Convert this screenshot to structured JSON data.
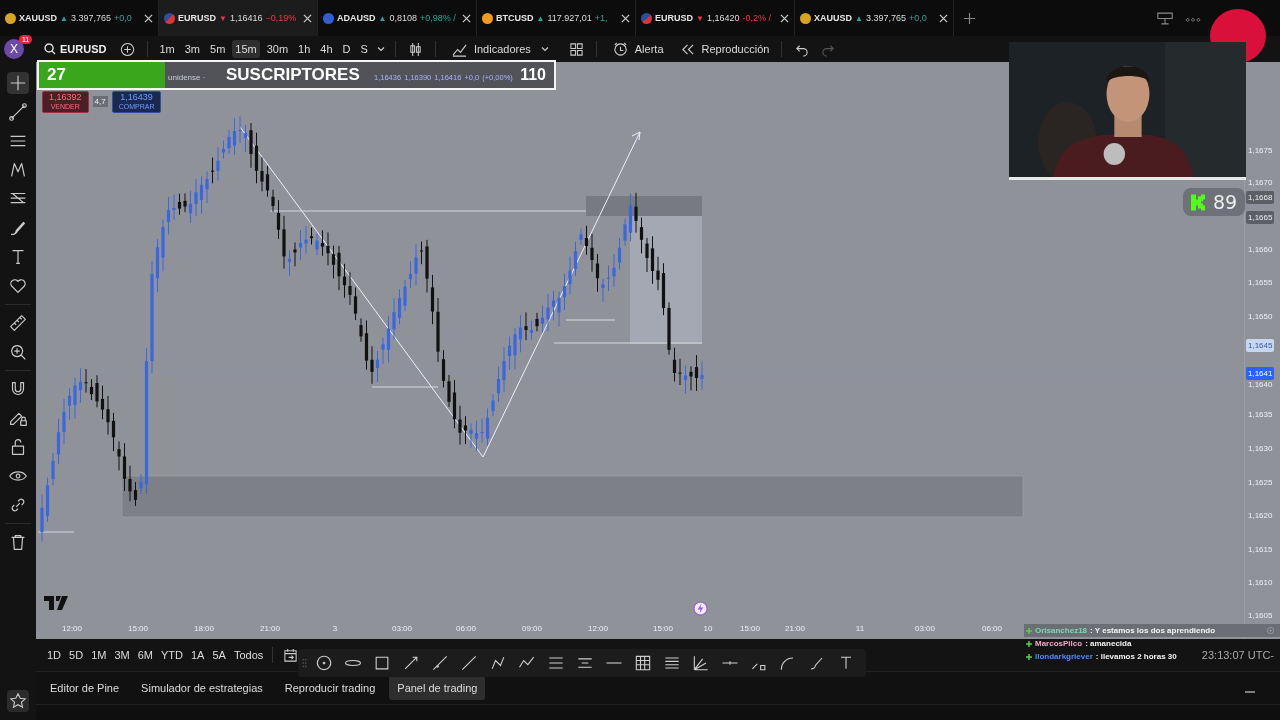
{
  "tabs": [
    {
      "symbol": "XAUUSD",
      "falling": false,
      "arrow": "▲",
      "price": "3.397,765",
      "change": "+0,0",
      "selected": false
    },
    {
      "symbol": "EURUSD",
      "falling": true,
      "arrow": "▼",
      "price": "1,16416",
      "change": "−0,19%",
      "selected": true
    },
    {
      "symbol": "ADAUSD",
      "falling": false,
      "arrow": "▲",
      "price": "0,8108",
      "change": "+0,98% /",
      "selected": false
    },
    {
      "symbol": "BTCUSD",
      "falling": false,
      "arrow": "▲",
      "price": "117.927,01",
      "change": "+1,",
      "selected": false
    },
    {
      "symbol": "EURUSD",
      "falling": true,
      "arrow": "▼",
      "price": "1,16420",
      "change": "-0,2% /",
      "selected": false
    },
    {
      "symbol": "XAUUSD",
      "falling": false,
      "arrow": "▲",
      "price": "3.397,765",
      "change": "+0,0",
      "selected": false
    }
  ],
  "toolbar": {
    "avatar": "X",
    "notifications": "11",
    "symbol": "EURUSD",
    "intervals": [
      {
        "label": "1m",
        "selected": false
      },
      {
        "label": "3m",
        "selected": false
      },
      {
        "label": "5m",
        "selected": false
      },
      {
        "label": "15m",
        "selected": true
      },
      {
        "label": "30m",
        "selected": false
      },
      {
        "label": "1h",
        "selected": false
      },
      {
        "label": "4h",
        "selected": false
      },
      {
        "label": "D",
        "selected": false
      },
      {
        "label": "S",
        "selected": false
      }
    ],
    "indicators": "Indicadores",
    "alert": "Alerta",
    "replay": "Reproducción"
  },
  "subscribers": {
    "count": "27",
    "label": "SUSCRIPTORES",
    "goal": "110",
    "level": 0.245
  },
  "legend": {
    "prefix": "unidense ·",
    "values": [
      "1,16436",
      "1,16390",
      "1,16416",
      "+0,0",
      "(+0,00%)"
    ]
  },
  "order": {
    "sell_price": "1,16392",
    "sell_label": "VENDER",
    "spread": "4,7",
    "buy_price": "1,16439",
    "buy_label": "COMPRAR"
  },
  "price_axis": [
    "1,1675",
    "1,1670",
    "1,1660",
    "1,1655",
    "1,1650",
    "1,1640",
    "1,1635",
    "1,1630",
    "1,1625",
    "1,1620",
    "1,1615",
    "1,1610",
    "1,1605"
  ],
  "price_tags": [
    {
      "value": "1,1668",
      "kind": "dark"
    },
    {
      "value": "1,1665",
      "kind": "dark"
    },
    {
      "value": "1,1645",
      "kind": "light"
    },
    {
      "value": "1,1641",
      "kind": "current"
    }
  ],
  "time_axis": [
    "12:00",
    "15:00",
    "18:00",
    "21:00",
    "3",
    "03:00",
    "06:00",
    "09:00",
    "12:00",
    "15:00",
    "10",
    "15:00",
    "21:00",
    "11",
    "03:00",
    "06:00"
  ],
  "kick_badge": {
    "count": "89"
  },
  "chat": [
    {
      "user": "Orisanchez18",
      "color": "#7fd6b4",
      "text": ": Y estamos los dos aprendiendo"
    },
    {
      "user": "MarcosPilco",
      "color": "#f0a8c8",
      "text": ": amanecida"
    },
    {
      "user": "llondarkgriever",
      "color": "#4a8ef0",
      "text": ": llevamos 2 horas 30"
    }
  ],
  "ranges": [
    "1D",
    "5D",
    "1M",
    "3M",
    "6M",
    "YTD",
    "1A",
    "5A",
    "Todos"
  ],
  "clock": "23:13:07 UTC-",
  "bottom_tabs": [
    {
      "label": "Editor de Pine",
      "selected": false
    },
    {
      "label": "Simulador de estrategias",
      "selected": false
    },
    {
      "label": "Reproducir trading",
      "selected": false
    },
    {
      "label": "Panel de trading",
      "selected": true
    }
  ]
}
